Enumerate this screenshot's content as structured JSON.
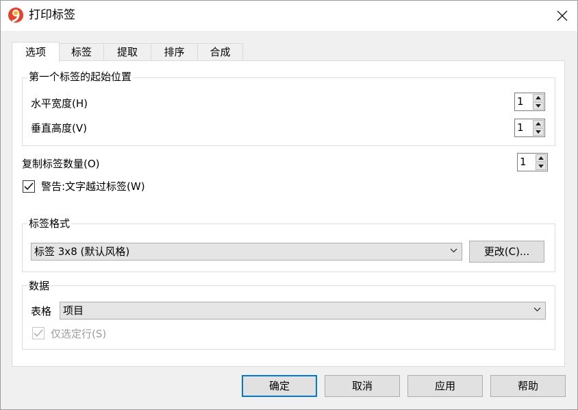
{
  "window": {
    "title": "打印标签"
  },
  "tabs": [
    "选项",
    "标签",
    "提取",
    "排序",
    "合成"
  ],
  "start_position": {
    "group_label": "第一个标签的起始位置",
    "horizontal_label": "水平宽度(H)",
    "horizontal_value": "1",
    "vertical_label": "垂直高度(V)",
    "vertical_value": "1"
  },
  "copies": {
    "label": "复制标签数量(O)",
    "value": "1"
  },
  "warning": {
    "label": "警告:文字越过标签(W)",
    "checked": true
  },
  "label_format": {
    "group_label": "标签格式",
    "selected": "标签 3x8 (默认风格)",
    "change_button": "更改(C)..."
  },
  "data_group": {
    "group_label": "数据",
    "table_label": "表格",
    "table_selected": "项目",
    "selected_rows_only_label": "仅选定行(S)",
    "selected_rows_only_checked": true
  },
  "footer": {
    "ok": "确定",
    "cancel": "取消",
    "apply": "应用",
    "help": "帮助"
  },
  "colors": {
    "accent": "#0078d7",
    "logo_red": "#e8402a",
    "logo_yellow": "#f7b31c"
  }
}
